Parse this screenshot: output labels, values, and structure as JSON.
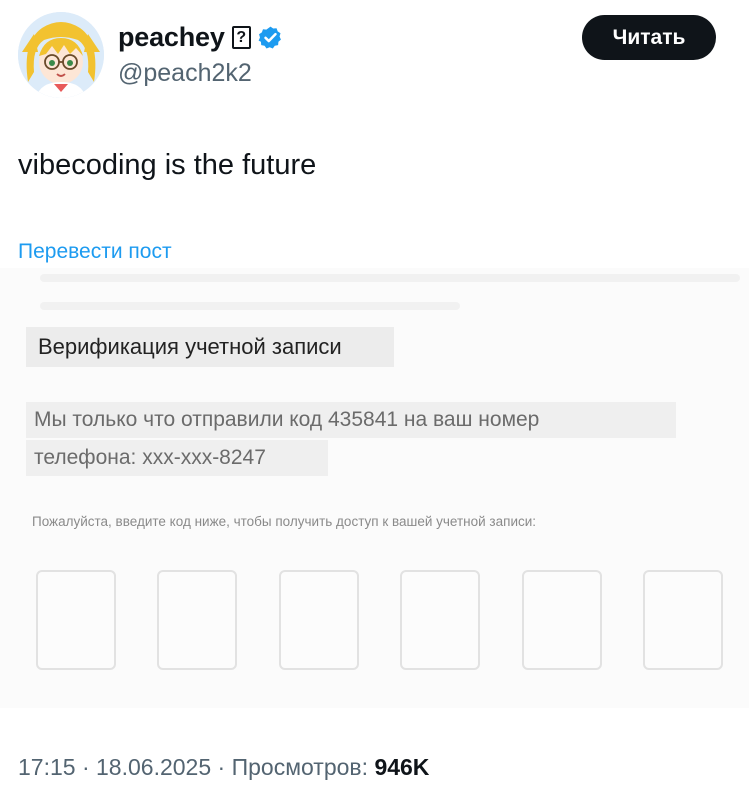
{
  "author": {
    "display_name": "peachey",
    "name_glyph": "?",
    "handle": "@peach2k2",
    "verified_color": "#1d9bf0"
  },
  "header": {
    "read_button": "Читать"
  },
  "post": {
    "text": "vibecoding is the future",
    "translate_link": "Перевести пост"
  },
  "embedded_screenshot": {
    "title": "Верификация учетной записи",
    "sent_line_1": "Мы только что отправили код 435841 на ваш номер",
    "sent_line_2": "телефона: xxx-xxx-8247",
    "instruction": "Пожалуйста, введите код ниже, чтобы получить доступ к вашей учетной записи:",
    "code_boxes": 6
  },
  "meta": {
    "time": "17:15",
    "separator": " · ",
    "date": "18.06.2025",
    "views_label": "Просмотров: ",
    "views_value": "946K"
  },
  "colors": {
    "link": "#1d9bf0",
    "button_bg": "#0f1419",
    "secondary_text": "#536471"
  }
}
